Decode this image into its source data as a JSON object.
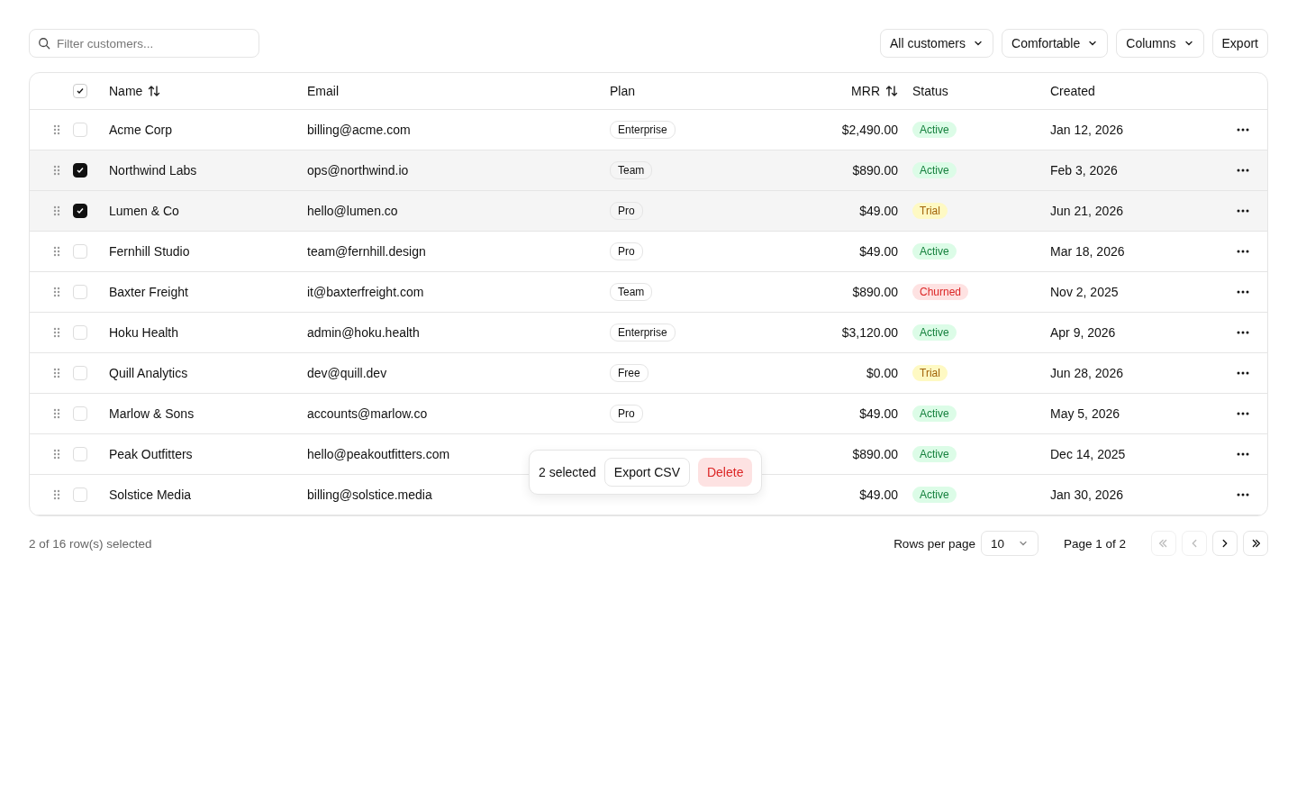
{
  "search": {
    "placeholder": "Filter customers..."
  },
  "toolbar": [
    {
      "label": "All customers",
      "kind": "dropdown"
    },
    {
      "label": "Comfortable",
      "kind": "dropdown"
    },
    {
      "label": "Columns",
      "kind": "dropdown"
    },
    {
      "label": "Export",
      "kind": "plain"
    }
  ],
  "table": {
    "select_all": {
      "checked": true
    },
    "columns": [
      {
        "label": "Name",
        "sortable": true
      },
      {
        "label": "Email",
        "sortable": false
      },
      {
        "label": "Plan",
        "sortable": false
      },
      {
        "label": "MRR",
        "sortable": true
      },
      {
        "label": "Status",
        "sortable": false
      },
      {
        "label": "Created",
        "sortable": false
      }
    ],
    "rows": [
      {
        "selected": false,
        "name": "Acme Corp",
        "email": "billing@acme.com",
        "plan": "Enterprise",
        "mrr": "$2,490.00",
        "status": {
          "label": "Active",
          "kind": "active"
        },
        "created": "Jan 12, 2026"
      },
      {
        "selected": true,
        "name": "Northwind Labs",
        "email": "ops@northwind.io",
        "plan": "Team",
        "mrr": "$890.00",
        "status": {
          "label": "Active",
          "kind": "active"
        },
        "created": "Feb 3, 2026"
      },
      {
        "selected": true,
        "name": "Lumen & Co",
        "email": "hello@lumen.co",
        "plan": "Pro",
        "mrr": "$49.00",
        "status": {
          "label": "Trial",
          "kind": "trial"
        },
        "created": "Jun 21, 2026"
      },
      {
        "selected": false,
        "name": "Fernhill Studio",
        "email": "team@fernhill.design",
        "plan": "Pro",
        "mrr": "$49.00",
        "status": {
          "label": "Active",
          "kind": "active"
        },
        "created": "Mar 18, 2026"
      },
      {
        "selected": false,
        "name": "Baxter Freight",
        "email": "it@baxterfreight.com",
        "plan": "Team",
        "mrr": "$890.00",
        "status": {
          "label": "Churned",
          "kind": "churned"
        },
        "created": "Nov 2, 2025"
      },
      {
        "selected": false,
        "name": "Hoku Health",
        "email": "admin@hoku.health",
        "plan": "Enterprise",
        "mrr": "$3,120.00",
        "status": {
          "label": "Active",
          "kind": "active"
        },
        "created": "Apr 9, 2026"
      },
      {
        "selected": false,
        "name": "Quill Analytics",
        "email": "dev@quill.dev",
        "plan": "Free",
        "mrr": "$0.00",
        "status": {
          "label": "Trial",
          "kind": "trial"
        },
        "created": "Jun 28, 2026"
      },
      {
        "selected": false,
        "name": "Marlow & Sons",
        "email": "accounts@marlow.co",
        "plan": "Pro",
        "mrr": "$49.00",
        "status": {
          "label": "Active",
          "kind": "active"
        },
        "created": "May 5, 2026"
      },
      {
        "selected": false,
        "name": "Peak Outfitters",
        "email": "hello@peakoutfitters.com",
        "mrr": "$890.00",
        "status": {
          "label": "Active",
          "kind": "active"
        },
        "created": "Dec 14, 2025"
      },
      {
        "selected": false,
        "name": "Solstice Media",
        "email": "billing@solstice.media",
        "mrr": "$49.00",
        "status": {
          "label": "Active",
          "kind": "active"
        },
        "created": "Jan 30, 2026"
      }
    ]
  },
  "bulk_bar": {
    "count": "2 selected",
    "actions": [
      {
        "label": "Export CSV",
        "kind": "outline"
      },
      {
        "label": "Delete",
        "kind": "danger"
      }
    ]
  },
  "footer": {
    "selection": "2 of 16 row(s) selected",
    "rows_per_page_label": "Rows per page",
    "rows_per_page": "10",
    "page": "Page 1 of 2",
    "pager": [
      {
        "kind": "first",
        "disabled": true
      },
      {
        "kind": "prev",
        "disabled": true
      },
      {
        "kind": "next",
        "disabled": false
      },
      {
        "kind": "last",
        "disabled": false
      }
    ]
  }
}
